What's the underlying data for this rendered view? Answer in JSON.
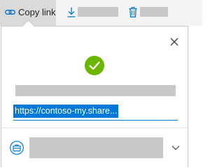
{
  "command_bar": {
    "copy_link_label": "Copy link",
    "icons": {
      "copy_link": "link-icon",
      "download": "download-icon",
      "delete": "trash-icon"
    }
  },
  "share_panel": {
    "status_icon": "checkmark-circle-icon",
    "link_value": "https://contoso-my.share...",
    "close_icon": "close-icon",
    "settings_icon": "link-settings-icon",
    "expand_icon": "chevron-down-icon"
  },
  "colors": {
    "accent": "#0078d4",
    "success": "#6bb700",
    "selected_button": "#dadada",
    "placeholder": "#c8c8c8"
  }
}
